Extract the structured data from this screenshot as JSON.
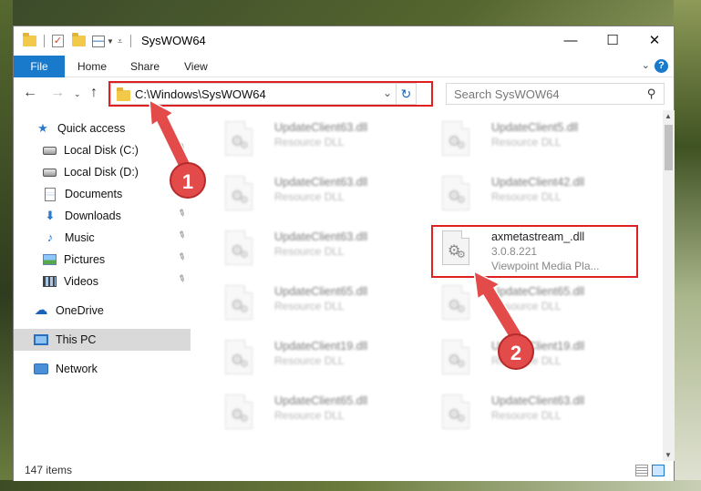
{
  "window": {
    "title": "SysWOW64",
    "minimize_glyph": "—",
    "maximize_glyph": "☐",
    "close_glyph": "✕"
  },
  "ribbon": {
    "tabs": [
      "File",
      "Home",
      "Share",
      "View"
    ],
    "accent": "#1979ca",
    "help": "?"
  },
  "navigation": {
    "address": "C:\\Windows\\SysWOW64",
    "search_placeholder": "Search SysWOW64"
  },
  "sidebar": {
    "items": [
      {
        "label": "Quick access",
        "icon": "star-icon"
      },
      {
        "label": "Local Disk (C:)",
        "icon": "drive-icon"
      },
      {
        "label": "Local Disk (D:)",
        "icon": "drive-icon"
      },
      {
        "label": "Documents",
        "icon": "documents-icon"
      },
      {
        "label": "Downloads",
        "icon": "download-icon"
      },
      {
        "label": "Music",
        "icon": "music-icon"
      },
      {
        "label": "Pictures",
        "icon": "pictures-icon"
      },
      {
        "label": "Videos",
        "icon": "videos-icon"
      },
      {
        "label": "OneDrive",
        "icon": "cloud-icon"
      },
      {
        "label": "This PC",
        "icon": "computer-icon"
      },
      {
        "label": "Network",
        "icon": "network-icon"
      }
    ]
  },
  "files": {
    "left": [
      {
        "name": "UpdateClient63.dll",
        "desc": "Resource DLL"
      },
      {
        "name": "UpdateClient63.dll",
        "desc": "Resource DLL"
      },
      {
        "name": "UpdateClient63.dll",
        "desc": "Resource DLL"
      },
      {
        "name": "UpdateClient65.dll",
        "desc": "Resource DLL"
      },
      {
        "name": "UpdateClient19.dll",
        "desc": "Resource DLL"
      },
      {
        "name": "UpdateClient65.dll",
        "desc": "Resource DLL"
      }
    ],
    "right": [
      {
        "name": "UpdateClient5.dll",
        "desc": "Resource DLL"
      },
      {
        "name": "UpdateClient42.dll",
        "desc": "Resource DLL"
      },
      {
        "name": "UpdateClient65.dll",
        "desc": "Resource DLL"
      },
      {
        "name": "UpdateClient19.dll",
        "desc": "Resource DLL"
      },
      {
        "name": "UpdateClient63.dll",
        "desc": "Resource DLL"
      }
    ],
    "highlighted": {
      "name": "axmetastream_.dll",
      "version": "3.0.8.221",
      "company": "Viewpoint Media Pla..."
    }
  },
  "status": {
    "item_count": "147 items"
  },
  "annotations": {
    "step1": "1",
    "step2": "2",
    "color": "#e34b4b"
  }
}
